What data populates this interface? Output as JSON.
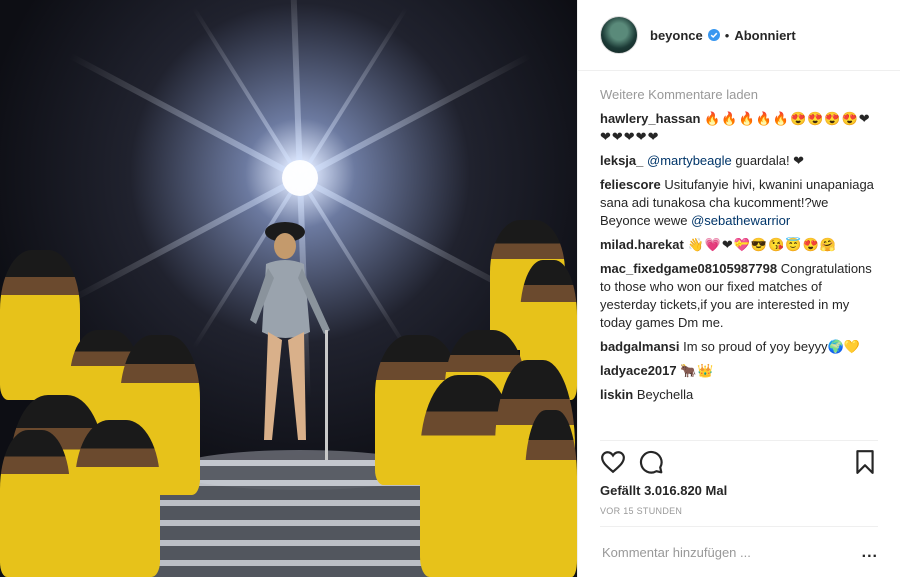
{
  "post": {
    "photo_alt": "beyonce performance photo"
  },
  "header": {
    "username": "beyonce",
    "separator": "•",
    "follow_state": "Abonniert"
  },
  "comments": {
    "load_more": "Weitere Kommentare laden",
    "items": [
      {
        "user": "hawlery_hassan",
        "text": "🔥🔥🔥🔥🔥😍😍😍😍❤❤❤❤❤❤"
      },
      {
        "user": "leksja_",
        "mention": "@martybeagle",
        "text": " guardala! ❤"
      },
      {
        "user": "feliescore",
        "text": "Usitufanyie hivi, kwanini unapaniaga sana adi tunakosa cha kucomment!?we Beyonce wewe ",
        "mention_after": "@sebathewarrior"
      },
      {
        "user": "milad.harekat",
        "text": "👋💗❤💝😎😘😇😍🤗"
      },
      {
        "user": "mac_fixedgame08105987798",
        "text": "Congratulations to those who won our fixed matches of yesterday tickets,if you are interested in my today games Dm me."
      },
      {
        "user": "badgalmansi",
        "text": "Im so proud of yoy beyyy🌍💛"
      },
      {
        "user": "ladyace2017",
        "text": "🐂👑"
      },
      {
        "user": "liskin",
        "text": "Beychella"
      }
    ]
  },
  "actions": {
    "likes": "Gefällt 3.016.820 Mal",
    "time": "VOR 15 STUNDEN"
  },
  "add_comment": {
    "placeholder": "Kommentar hinzufügen ...",
    "more": "..."
  }
}
